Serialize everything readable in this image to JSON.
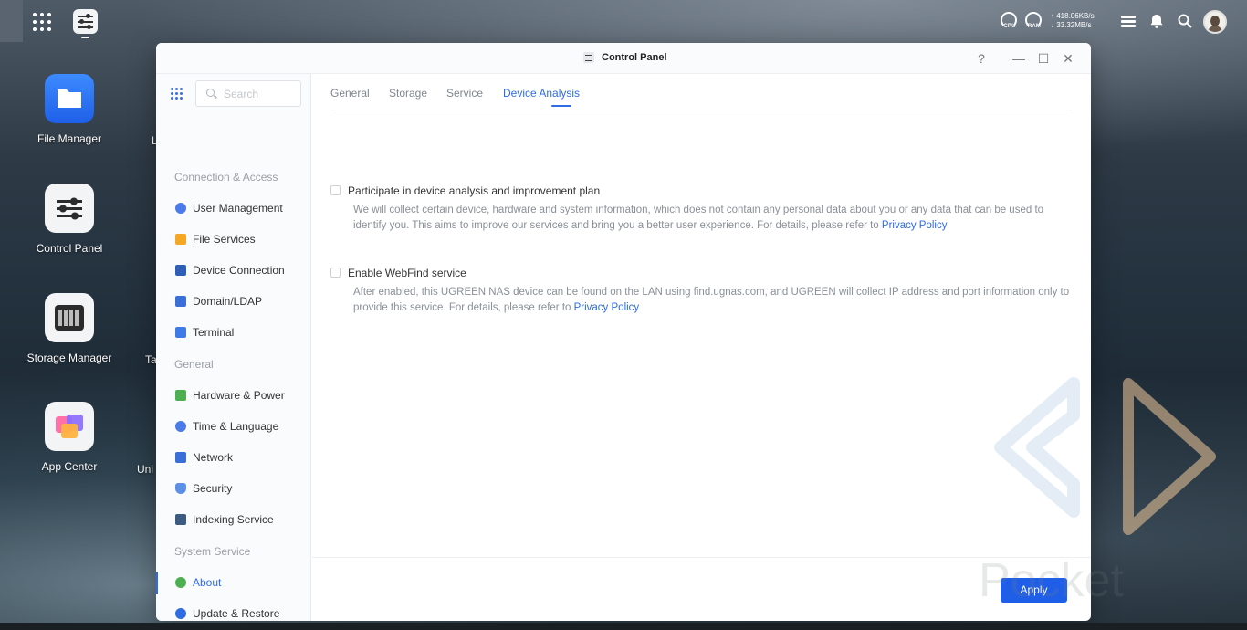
{
  "topbar": {
    "cpu_label": "CPU",
    "ram_label": "RAM",
    "upload_speed": "↑ 418.06KB/s",
    "download_speed": "↓ 33.32MB/s"
  },
  "desktop": {
    "icons": [
      {
        "label": "File Manager"
      },
      {
        "label": "Control Panel"
      },
      {
        "label": "Storage Manager"
      },
      {
        "label": "App Center"
      }
    ],
    "peek": [
      "L",
      "Ta",
      "Uni"
    ]
  },
  "window": {
    "title": "Control Panel",
    "help": "?",
    "minimize": "—",
    "maximize": "☐",
    "close": "✕"
  },
  "sidebar": {
    "search_placeholder": "Search",
    "sections": {
      "connection": "Connection & Access",
      "general": "General",
      "system": "System Service"
    },
    "items": [
      {
        "label": "User Management",
        "color": "#4a7be8"
      },
      {
        "label": "File Services",
        "color": "#f5a623"
      },
      {
        "label": "Device Connection",
        "color": "#2e5fb8"
      },
      {
        "label": "Domain/LDAP",
        "color": "#3a6fd8"
      },
      {
        "label": "Terminal",
        "color": "#3f7be6"
      },
      {
        "label": "Hardware & Power",
        "color": "#4caf50"
      },
      {
        "label": "Time & Language",
        "color": "#4a7be8"
      },
      {
        "label": "Network",
        "color": "#3a6fd8"
      },
      {
        "label": "Security",
        "color": "#5b8fe8"
      },
      {
        "label": "Indexing Service",
        "color": "#3d5a80"
      },
      {
        "label": "About",
        "color": "#4caf50"
      },
      {
        "label": "Update & Restore",
        "color": "#2f6be3"
      }
    ]
  },
  "tabs": [
    "General",
    "Storage",
    "Service",
    "Device Analysis"
  ],
  "options": [
    {
      "title": "Participate in device analysis and improvement plan",
      "desc": "We will collect certain device, hardware and system information, which does not contain any personal data about you or any data that can be used to identify you. This aims to improve our services and bring you a better user experience. For details, please refer to ",
      "link": "Privacy Policy",
      "checked": false
    },
    {
      "title": "Enable WebFind service",
      "desc": "After enabled, this UGREEN NAS device can be found on the LAN using find.ugnas.com, and UGREEN will collect IP address and port information only to provide this service. For details, please refer to ",
      "link": "Privacy Policy",
      "checked": false
    }
  ],
  "footer": {
    "apply_label": "Apply"
  },
  "watermark": "Pocket",
  "colors": {
    "accent": "#2f6be3",
    "apply_button": "#1f5fe8"
  }
}
